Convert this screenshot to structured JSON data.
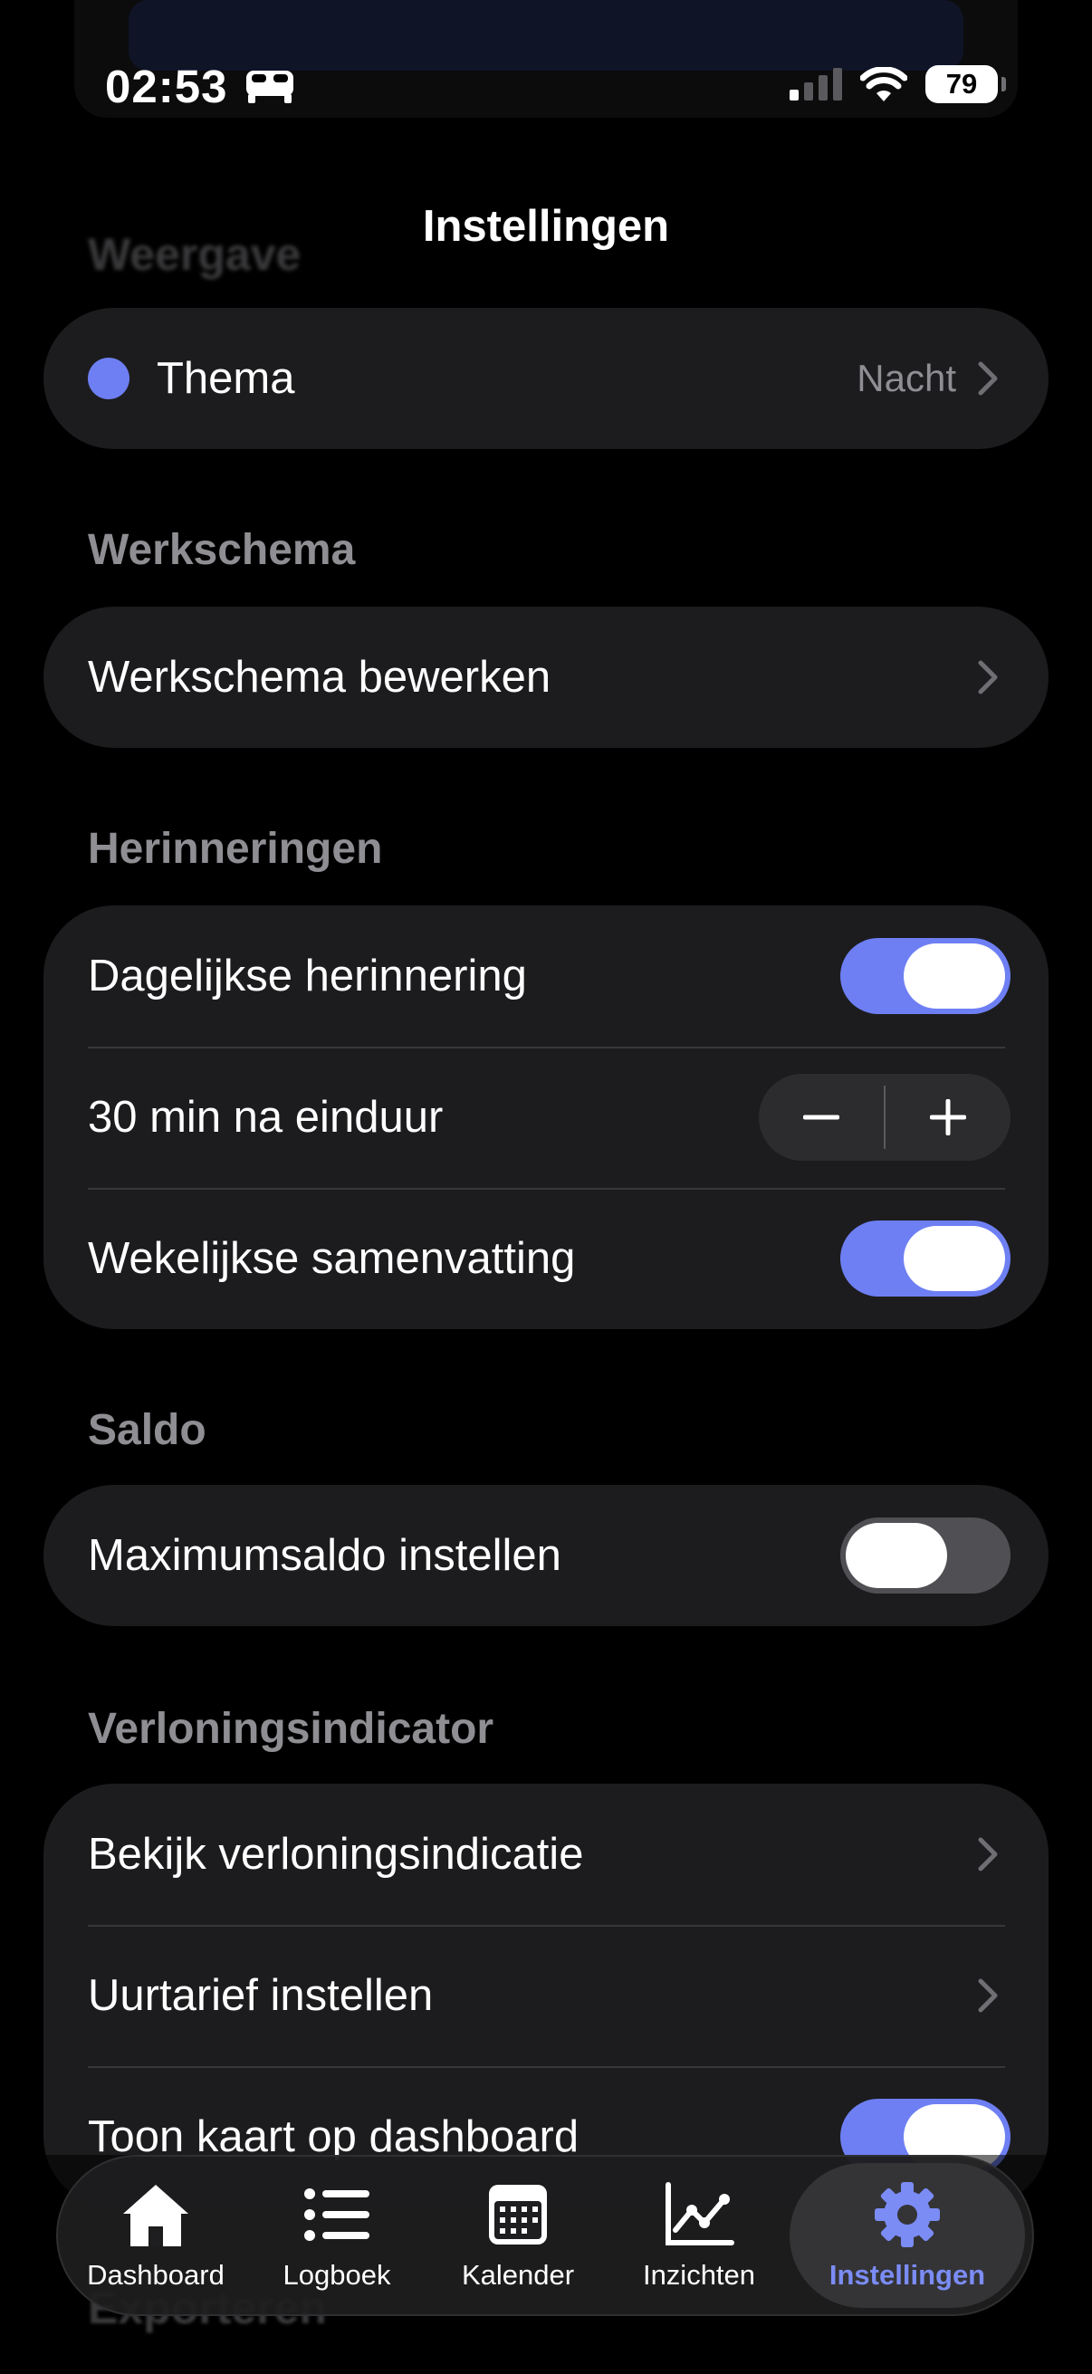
{
  "status_bar": {
    "time": "02:53",
    "battery": "79",
    "icons": [
      "sleep-focus-icon",
      "cellular-signal-icon",
      "wifi-icon",
      "battery-icon"
    ]
  },
  "nav": {
    "title": "Instellingen"
  },
  "ghost_header": "Weergave",
  "ghost_footer": "Exporteren",
  "theme": {
    "label": "Thema",
    "value": "Nacht",
    "dot_color": "#6e7ff3"
  },
  "sections": {
    "werkschema": {
      "header": "Werkschema",
      "edit_label": "Werkschema bewerken"
    },
    "herinneringen": {
      "header": "Herinneringen",
      "daily_label": "Dagelijkse herinnering",
      "daily_on": true,
      "offset_label": "30 min na einduur",
      "weekly_label": "Wekelijkse samenvatting",
      "weekly_on": true
    },
    "saldo": {
      "header": "Saldo",
      "max_label": "Maximumsaldo instellen",
      "max_on": false
    },
    "verloning": {
      "header": "Verloningsindicator",
      "view_label": "Bekijk verloningsindicatie",
      "rate_label": "Uurtarief instellen",
      "card_label": "Toon kaart op dashboard",
      "card_on": true
    }
  },
  "tabs": [
    {
      "label": "Dashboard",
      "icon": "house-icon"
    },
    {
      "label": "Logboek",
      "icon": "list-icon"
    },
    {
      "label": "Kalender",
      "icon": "calendar-icon"
    },
    {
      "label": "Inzichten",
      "icon": "chart-icon"
    },
    {
      "label": "Instellingen",
      "icon": "gear-icon",
      "active": true
    }
  ],
  "colors": {
    "accent": "#6e7ff3",
    "background": "#000000",
    "card": "#1c1c1e",
    "secondary_text": "#8e8e93"
  }
}
